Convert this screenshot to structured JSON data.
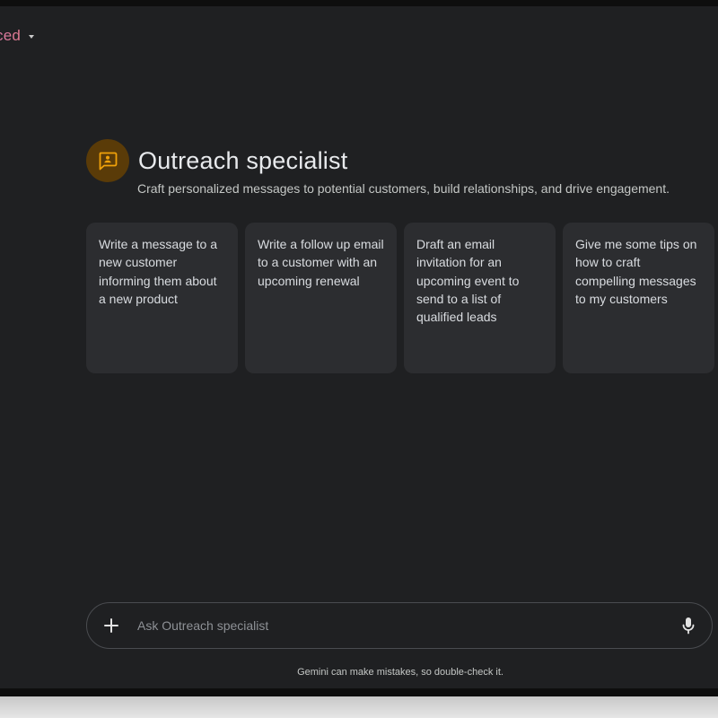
{
  "header": {
    "model_label": "ced"
  },
  "gem": {
    "icon": "chat-bubble-person-icon",
    "title": "Outreach specialist",
    "description": "Craft personalized messages to potential customers, build relationships, and drive engagement."
  },
  "suggestions": [
    {
      "text": "Write a message to a new customer informing them about a new product"
    },
    {
      "text": "Write a follow up email to a customer with an upcoming renewal"
    },
    {
      "text": "Draft an email invitation for an upcoming event to send to a list of qualified leads"
    },
    {
      "text": "Give me some tips on how to craft compelling messages to my customers"
    }
  ],
  "input": {
    "value": "",
    "placeholder": "Ask Outreach specialist",
    "add_icon": "plus-icon",
    "mic_icon": "microphone-icon"
  },
  "footer": {
    "disclaimer": "Gemini can make mistakes, so double-check it."
  },
  "colors": {
    "background": "#1f2022",
    "card": "#2c2d30",
    "avatar_bg": "#5a3b08",
    "avatar_icon": "#f0a10a",
    "accent_text": "#d97aa6"
  }
}
